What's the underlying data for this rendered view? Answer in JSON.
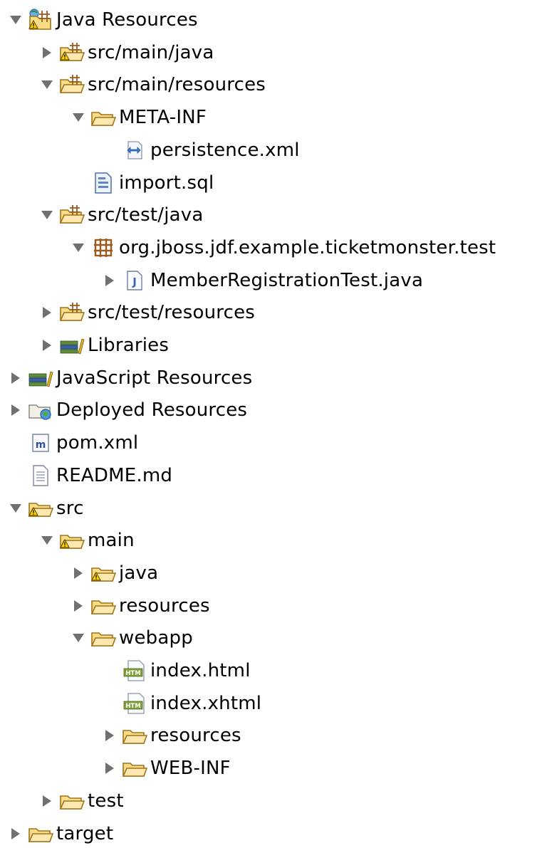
{
  "tree": [
    {
      "label": "Java Resources",
      "depth": 0,
      "toggle": "expanded",
      "icon": "java-resources-icon"
    },
    {
      "label": "src/main/java",
      "depth": 1,
      "toggle": "collapsed",
      "icon": "source-folder-warning-icon"
    },
    {
      "label": "src/main/resources",
      "depth": 1,
      "toggle": "expanded",
      "icon": "source-folder-icon"
    },
    {
      "label": "META-INF",
      "depth": 2,
      "toggle": "expanded",
      "icon": "folder-open-icon"
    },
    {
      "label": "persistence.xml",
      "depth": 3,
      "toggle": "none",
      "icon": "xml-file-icon"
    },
    {
      "label": "import.sql",
      "depth": 2,
      "toggle": "none",
      "icon": "sql-file-icon"
    },
    {
      "label": "src/test/java",
      "depth": 1,
      "toggle": "expanded",
      "icon": "source-folder-icon"
    },
    {
      "label": "org.jboss.jdf.example.ticketmonster.test",
      "depth": 2,
      "toggle": "expanded",
      "icon": "package-icon"
    },
    {
      "label": "MemberRegistrationTest.java",
      "depth": 3,
      "toggle": "collapsed",
      "icon": "java-file-icon"
    },
    {
      "label": "src/test/resources",
      "depth": 1,
      "toggle": "collapsed",
      "icon": "source-folder-icon"
    },
    {
      "label": "Libraries",
      "depth": 1,
      "toggle": "collapsed",
      "icon": "libraries-icon"
    },
    {
      "label": "JavaScript Resources",
      "depth": 0,
      "toggle": "collapsed",
      "icon": "libraries-icon"
    },
    {
      "label": "Deployed Resources",
      "depth": 0,
      "toggle": "collapsed",
      "icon": "deployed-resources-icon"
    },
    {
      "label": "pom.xml",
      "depth": 0,
      "toggle": "none",
      "icon": "maven-pom-icon"
    },
    {
      "label": "README.md",
      "depth": 0,
      "toggle": "none",
      "icon": "text-file-icon"
    },
    {
      "label": "src",
      "depth": 0,
      "toggle": "expanded",
      "icon": "folder-warning-icon"
    },
    {
      "label": "main",
      "depth": 1,
      "toggle": "expanded",
      "icon": "folder-warning-icon"
    },
    {
      "label": "java",
      "depth": 2,
      "toggle": "collapsed",
      "icon": "folder-warning-icon"
    },
    {
      "label": "resources",
      "depth": 2,
      "toggle": "collapsed",
      "icon": "folder-open-icon"
    },
    {
      "label": "webapp",
      "depth": 2,
      "toggle": "expanded",
      "icon": "folder-open-icon"
    },
    {
      "label": "index.html",
      "depth": 3,
      "toggle": "none",
      "icon": "html-file-icon"
    },
    {
      "label": "index.xhtml",
      "depth": 3,
      "toggle": "none",
      "icon": "html-file-icon"
    },
    {
      "label": "resources",
      "depth": 3,
      "toggle": "collapsed",
      "icon": "folder-open-icon"
    },
    {
      "label": "WEB-INF",
      "depth": 3,
      "toggle": "collapsed",
      "icon": "folder-open-icon"
    },
    {
      "label": "test",
      "depth": 1,
      "toggle": "collapsed",
      "icon": "folder-open-icon"
    },
    {
      "label": "target",
      "depth": 0,
      "toggle": "collapsed",
      "icon": "folder-open-icon"
    }
  ],
  "colors": {
    "folder_fill": "#f8dc86",
    "folder_stroke": "#a0741c",
    "package_brown": "#9b5a1e",
    "warning_yellow": "#ffd400",
    "java_blue": "#3a64b5",
    "maven_blue": "#2a4f9a",
    "html_green": "#7fa23c",
    "text": "#000000"
  }
}
